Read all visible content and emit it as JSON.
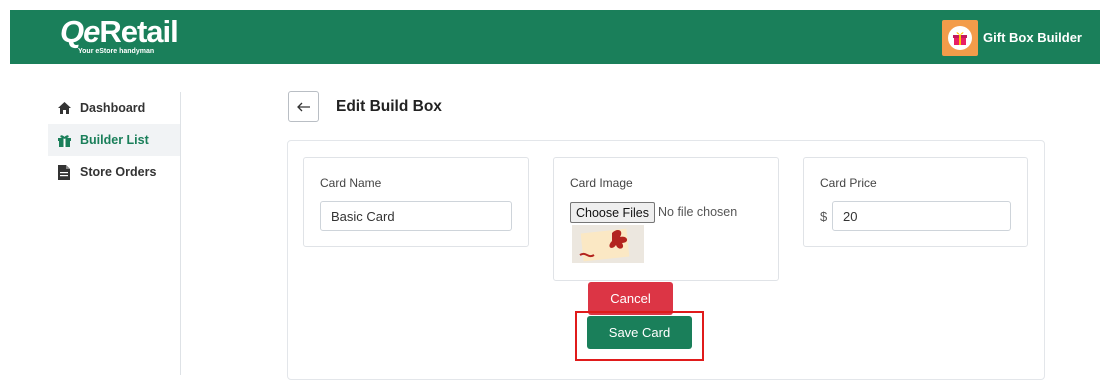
{
  "brand": {
    "logo_text": "Retail",
    "logo_prefix": "Qe",
    "tagline": "Your eStore handyman",
    "app_name": "Gift Box Builder",
    "color": "#1a7f5a"
  },
  "sidebar": {
    "items": [
      {
        "label": "Dashboard",
        "icon": "home-icon"
      },
      {
        "label": "Builder List",
        "icon": "gift-icon",
        "active": true
      },
      {
        "label": "Store Orders",
        "icon": "document-icon"
      }
    ]
  },
  "header": {
    "title": "Edit Build Box",
    "back_icon": "arrow-left-icon"
  },
  "form": {
    "card_name": {
      "label": "Card Name",
      "value": "Basic Card"
    },
    "card_image": {
      "label": "Card Image",
      "button": "Choose Files",
      "status": "No file chosen"
    },
    "card_price": {
      "label": "Card Price",
      "currency": "$",
      "value": "20"
    }
  },
  "actions": {
    "cancel_label": "Cancel",
    "save_label": "Save Card",
    "cancel_color": "#dc3545",
    "save_color": "#1a7f5a",
    "highlight_color": "#e01b1b"
  }
}
